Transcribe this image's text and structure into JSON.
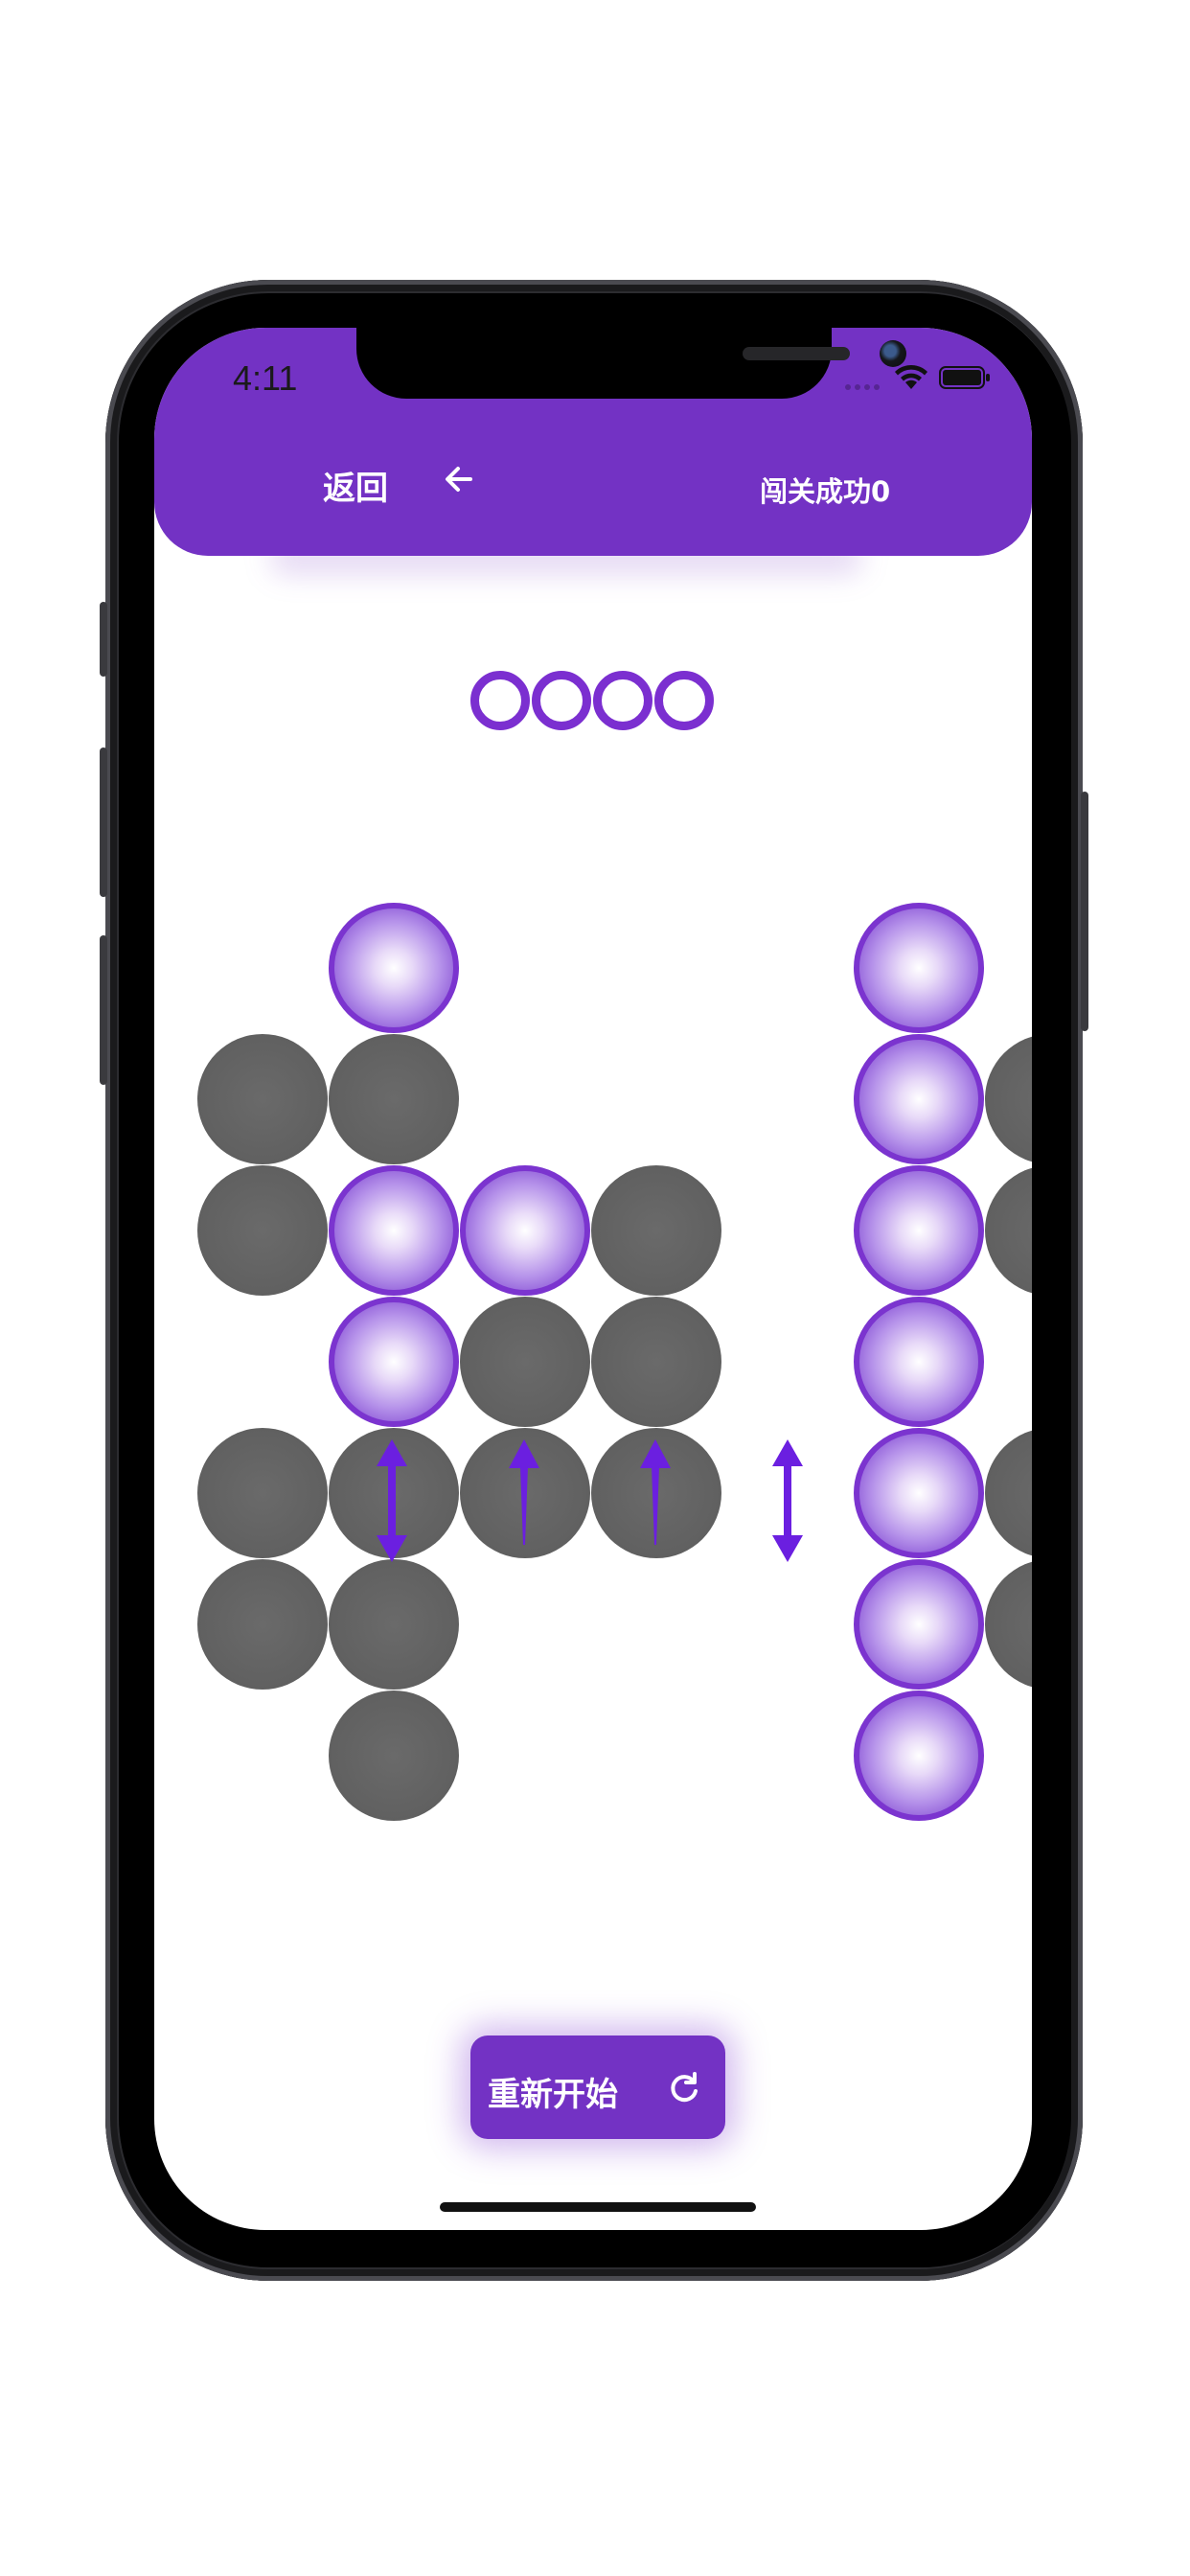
{
  "status_bar": {
    "time": "4:11"
  },
  "header": {
    "back_label": "返回",
    "score_label": "闯关成功0",
    "color": "#7332c4"
  },
  "level_indicator": {
    "count": 4,
    "icon": "ring-icon"
  },
  "board": {
    "on_color": "#7b34cf",
    "off_color": "#5f5f5f",
    "rows": [
      [
        0,
        1,
        0,
        0,
        0,
        1,
        0
      ],
      [
        2,
        2,
        0,
        0,
        0,
        1,
        2
      ],
      [
        2,
        1,
        1,
        2,
        0,
        1,
        2
      ],
      [
        0,
        1,
        2,
        2,
        0,
        1,
        0
      ],
      [
        2,
        2,
        2,
        2,
        0,
        1,
        2
      ],
      [
        2,
        2,
        0,
        0,
        0,
        1,
        2
      ],
      [
        0,
        2,
        0,
        0,
        0,
        1,
        0
      ]
    ],
    "legend": {
      "0": "empty",
      "1": "lit",
      "2": "unlit"
    }
  },
  "restart": {
    "label": "重新开始",
    "icon": "refresh-icon"
  }
}
